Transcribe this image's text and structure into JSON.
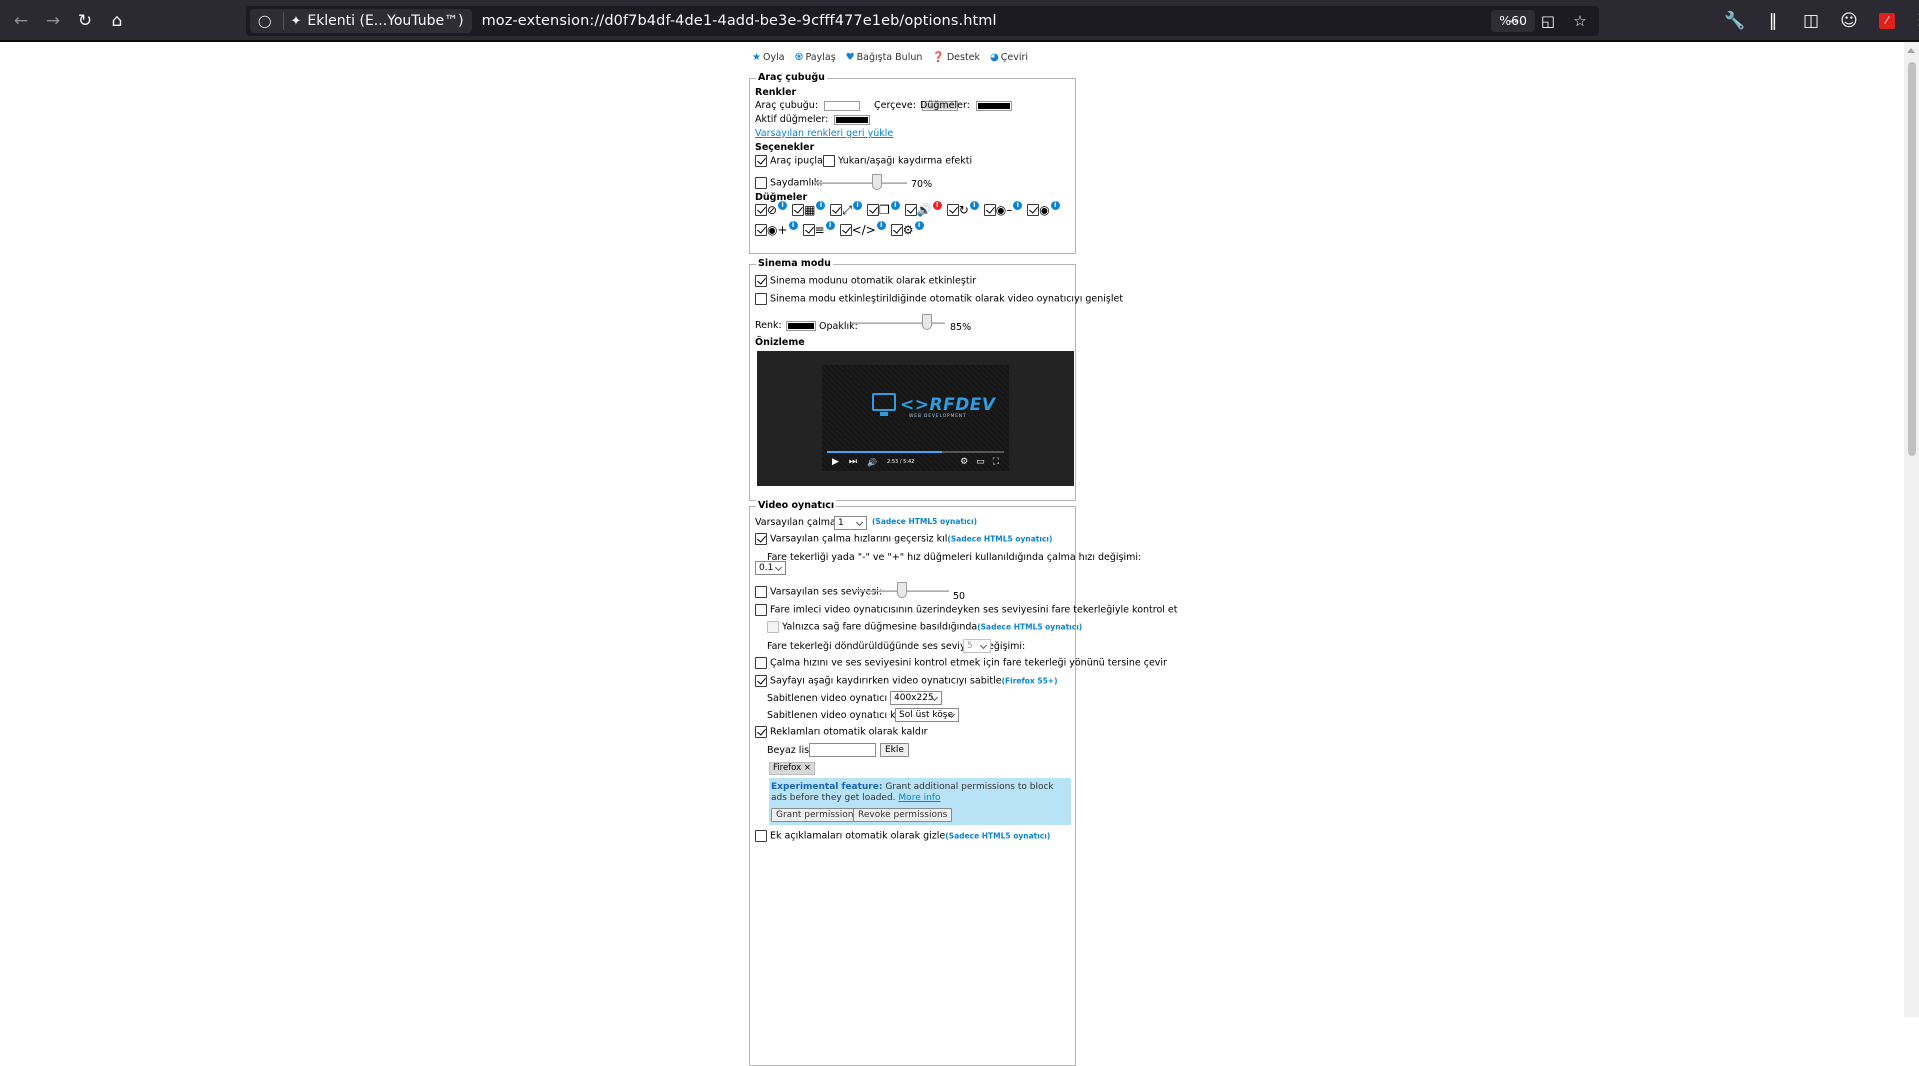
{
  "browser": {
    "tab_title": "Eklenti (E...YouTube™)",
    "url": "moz-extension://d0f7b4df-4de1-4add-be3e-9cfff477e1eb/options.html",
    "zoom": "%60"
  },
  "topnav": {
    "rate": "Oyla",
    "share": "Paylaş",
    "donate": "Bağışta Bulun",
    "support": "Destek",
    "translate": "Çeviri"
  },
  "toolbar_section": {
    "legend": "Araç çubuğu",
    "colors_heading": "Renkler",
    "toolbar_label": "Araç çubuğu:",
    "toolbar_color": "#ffffff",
    "border_label": "Çerçeve:",
    "border_color": "#d0d0d0",
    "buttons_label": "Düğmeler:",
    "buttons_color": "#000000",
    "active_buttons_label": "Aktif düğmeler:",
    "active_buttons_color": "#000000",
    "reset_colors_link": "Varsayılan renkleri geri yükle",
    "options_heading": "Seçenekler",
    "tooltips_label": "Araç ipuçları",
    "tooltips_checked": true,
    "scroll_effect_label": "Yukarı/aşağı kaydırma efekti",
    "scroll_effect_checked": false,
    "transparency_label": "Saydamlık:",
    "transparency_checked": false,
    "transparency_value": "70%",
    "transparency_level": 0.7,
    "buttons_heading": "Düğmeler",
    "button_icons_row1": [
      "block-icon",
      "film-icon",
      "expand-icon",
      "copy-icon",
      "volume-icon",
      "loop-icon",
      "speed-minus-icon",
      "speed-icon"
    ],
    "button_icons_row2": [
      "speed-plus-icon",
      "sliders-icon",
      "code-icon",
      "settings-icon"
    ]
  },
  "cinema_section": {
    "legend": "Sinema modu",
    "auto_enable_label": "Sinema modunu otomatik olarak etkinleştir",
    "auto_enable_checked": true,
    "auto_expand_label": "Sinema modu etkinleştirildiğinde otomatik olarak video oynatıcıyı genişlet",
    "auto_expand_checked": false,
    "color_label": "Renk:",
    "color_value": "#000000",
    "opacity_label": "Opaklık:",
    "opacity_value": "85%",
    "opacity_level": 0.85,
    "preview_heading": "Önizleme",
    "preview_logo": "<>RFDEV",
    "preview_logo_sub": "WEB DEVELOPMENT",
    "preview_time": "2:53 / 5:42"
  },
  "player_section": {
    "legend": "Video oynatıcı",
    "default_speed_label": "Varsayılan çalma hızı:",
    "default_speed_value": "1",
    "html5_only": "(Sadece HTML5 oynatıcı)",
    "override_speeds_label": "Varsayılan çalma hızlarını geçersiz kıl",
    "override_speeds_checked": true,
    "wheel_speed_label": "Fare tekerliği yada \"-\" ve \"+\" hız düğmeleri kullanıldığında çalma hızı değişimi:",
    "wheel_speed_value": "0.1",
    "default_volume_label": "Varsayılan ses seviyesi:",
    "default_volume_checked": false,
    "default_volume_value": "50",
    "default_volume_level": 0.5,
    "wheel_volume_label": "Fare imleci video oynatıcısının üzerindeyken ses seviyesini fare tekerleğiyle kontrol et",
    "wheel_volume_checked": false,
    "right_click_only_label": "Yalnızca sağ fare düğmesine basıldığında",
    "volume_step_label": "Fare tekerleği döndürüldüğünde ses seviyesi değişimi:",
    "volume_step_value": "5",
    "invert_wheel_label": "Çalma hızını ve ses seviyesini kontrol etmek için fare tekerleği yönünü tersine çevir",
    "invert_wheel_checked": false,
    "pin_player_label": "Sayfayı aşağı kaydırırken video oynatıcıyı sabitle",
    "pin_player_checked": true,
    "firefox_note": "(Firefox 55+)",
    "pinned_size_label": "Sabitlenen video oynatıcı boyutu:",
    "pinned_size_value": "400x225",
    "pinned_position_label": "Sabitlenen video oynatıcı konumu:",
    "pinned_position_value": "Sol üst köşe",
    "remove_ads_label": "Reklamları otomatik olarak kaldır",
    "remove_ads_checked": true,
    "whitelist_label": "Beyaz liste:",
    "whitelist_add": "Ekle",
    "whitelist_tag": "Firefox ×",
    "experimental_title": "Experimental feature:",
    "experimental_text": " Grant additional permissions to block ads before they get loaded.",
    "more_info": "More info",
    "grant_button": "Grant permissions",
    "revoke_button": "Revoke permissions",
    "hide_annotations_label": "Ek açıklamaları otomatik olarak gizle",
    "hide_annotations_checked": false
  }
}
